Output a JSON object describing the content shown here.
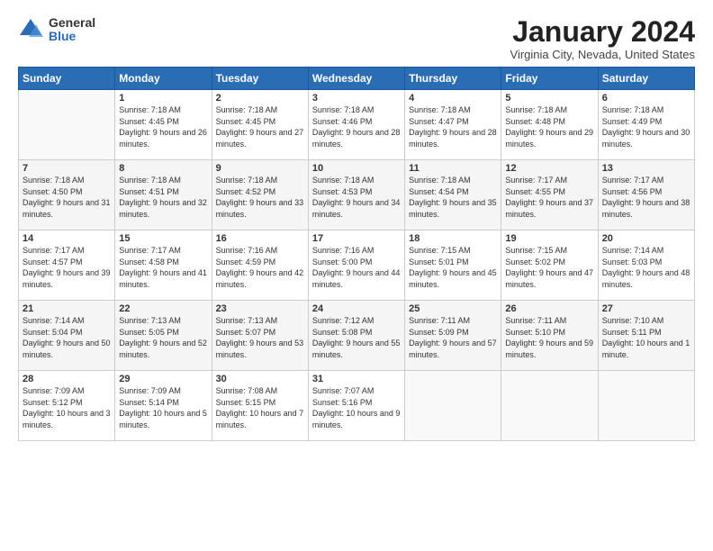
{
  "logo": {
    "general": "General",
    "blue": "Blue"
  },
  "title": "January 2024",
  "subtitle": "Virginia City, Nevada, United States",
  "days_header": [
    "Sunday",
    "Monday",
    "Tuesday",
    "Wednesday",
    "Thursday",
    "Friday",
    "Saturday"
  ],
  "weeks": [
    [
      {
        "day": "",
        "sunrise": "",
        "sunset": "",
        "daylight": ""
      },
      {
        "day": "1",
        "sunrise": "Sunrise: 7:18 AM",
        "sunset": "Sunset: 4:45 PM",
        "daylight": "Daylight: 9 hours and 26 minutes."
      },
      {
        "day": "2",
        "sunrise": "Sunrise: 7:18 AM",
        "sunset": "Sunset: 4:45 PM",
        "daylight": "Daylight: 9 hours and 27 minutes."
      },
      {
        "day": "3",
        "sunrise": "Sunrise: 7:18 AM",
        "sunset": "Sunset: 4:46 PM",
        "daylight": "Daylight: 9 hours and 28 minutes."
      },
      {
        "day": "4",
        "sunrise": "Sunrise: 7:18 AM",
        "sunset": "Sunset: 4:47 PM",
        "daylight": "Daylight: 9 hours and 28 minutes."
      },
      {
        "day": "5",
        "sunrise": "Sunrise: 7:18 AM",
        "sunset": "Sunset: 4:48 PM",
        "daylight": "Daylight: 9 hours and 29 minutes."
      },
      {
        "day": "6",
        "sunrise": "Sunrise: 7:18 AM",
        "sunset": "Sunset: 4:49 PM",
        "daylight": "Daylight: 9 hours and 30 minutes."
      }
    ],
    [
      {
        "day": "7",
        "sunrise": "Sunrise: 7:18 AM",
        "sunset": "Sunset: 4:50 PM",
        "daylight": "Daylight: 9 hours and 31 minutes."
      },
      {
        "day": "8",
        "sunrise": "Sunrise: 7:18 AM",
        "sunset": "Sunset: 4:51 PM",
        "daylight": "Daylight: 9 hours and 32 minutes."
      },
      {
        "day": "9",
        "sunrise": "Sunrise: 7:18 AM",
        "sunset": "Sunset: 4:52 PM",
        "daylight": "Daylight: 9 hours and 33 minutes."
      },
      {
        "day": "10",
        "sunrise": "Sunrise: 7:18 AM",
        "sunset": "Sunset: 4:53 PM",
        "daylight": "Daylight: 9 hours and 34 minutes."
      },
      {
        "day": "11",
        "sunrise": "Sunrise: 7:18 AM",
        "sunset": "Sunset: 4:54 PM",
        "daylight": "Daylight: 9 hours and 35 minutes."
      },
      {
        "day": "12",
        "sunrise": "Sunrise: 7:17 AM",
        "sunset": "Sunset: 4:55 PM",
        "daylight": "Daylight: 9 hours and 37 minutes."
      },
      {
        "day": "13",
        "sunrise": "Sunrise: 7:17 AM",
        "sunset": "Sunset: 4:56 PM",
        "daylight": "Daylight: 9 hours and 38 minutes."
      }
    ],
    [
      {
        "day": "14",
        "sunrise": "Sunrise: 7:17 AM",
        "sunset": "Sunset: 4:57 PM",
        "daylight": "Daylight: 9 hours and 39 minutes."
      },
      {
        "day": "15",
        "sunrise": "Sunrise: 7:17 AM",
        "sunset": "Sunset: 4:58 PM",
        "daylight": "Daylight: 9 hours and 41 minutes."
      },
      {
        "day": "16",
        "sunrise": "Sunrise: 7:16 AM",
        "sunset": "Sunset: 4:59 PM",
        "daylight": "Daylight: 9 hours and 42 minutes."
      },
      {
        "day": "17",
        "sunrise": "Sunrise: 7:16 AM",
        "sunset": "Sunset: 5:00 PM",
        "daylight": "Daylight: 9 hours and 44 minutes."
      },
      {
        "day": "18",
        "sunrise": "Sunrise: 7:15 AM",
        "sunset": "Sunset: 5:01 PM",
        "daylight": "Daylight: 9 hours and 45 minutes."
      },
      {
        "day": "19",
        "sunrise": "Sunrise: 7:15 AM",
        "sunset": "Sunset: 5:02 PM",
        "daylight": "Daylight: 9 hours and 47 minutes."
      },
      {
        "day": "20",
        "sunrise": "Sunrise: 7:14 AM",
        "sunset": "Sunset: 5:03 PM",
        "daylight": "Daylight: 9 hours and 48 minutes."
      }
    ],
    [
      {
        "day": "21",
        "sunrise": "Sunrise: 7:14 AM",
        "sunset": "Sunset: 5:04 PM",
        "daylight": "Daylight: 9 hours and 50 minutes."
      },
      {
        "day": "22",
        "sunrise": "Sunrise: 7:13 AM",
        "sunset": "Sunset: 5:05 PM",
        "daylight": "Daylight: 9 hours and 52 minutes."
      },
      {
        "day": "23",
        "sunrise": "Sunrise: 7:13 AM",
        "sunset": "Sunset: 5:07 PM",
        "daylight": "Daylight: 9 hours and 53 minutes."
      },
      {
        "day": "24",
        "sunrise": "Sunrise: 7:12 AM",
        "sunset": "Sunset: 5:08 PM",
        "daylight": "Daylight: 9 hours and 55 minutes."
      },
      {
        "day": "25",
        "sunrise": "Sunrise: 7:11 AM",
        "sunset": "Sunset: 5:09 PM",
        "daylight": "Daylight: 9 hours and 57 minutes."
      },
      {
        "day": "26",
        "sunrise": "Sunrise: 7:11 AM",
        "sunset": "Sunset: 5:10 PM",
        "daylight": "Daylight: 9 hours and 59 minutes."
      },
      {
        "day": "27",
        "sunrise": "Sunrise: 7:10 AM",
        "sunset": "Sunset: 5:11 PM",
        "daylight": "Daylight: 10 hours and 1 minute."
      }
    ],
    [
      {
        "day": "28",
        "sunrise": "Sunrise: 7:09 AM",
        "sunset": "Sunset: 5:12 PM",
        "daylight": "Daylight: 10 hours and 3 minutes."
      },
      {
        "day": "29",
        "sunrise": "Sunrise: 7:09 AM",
        "sunset": "Sunset: 5:14 PM",
        "daylight": "Daylight: 10 hours and 5 minutes."
      },
      {
        "day": "30",
        "sunrise": "Sunrise: 7:08 AM",
        "sunset": "Sunset: 5:15 PM",
        "daylight": "Daylight: 10 hours and 7 minutes."
      },
      {
        "day": "31",
        "sunrise": "Sunrise: 7:07 AM",
        "sunset": "Sunset: 5:16 PM",
        "daylight": "Daylight: 10 hours and 9 minutes."
      },
      {
        "day": "",
        "sunrise": "",
        "sunset": "",
        "daylight": ""
      },
      {
        "day": "",
        "sunrise": "",
        "sunset": "",
        "daylight": ""
      },
      {
        "day": "",
        "sunrise": "",
        "sunset": "",
        "daylight": ""
      }
    ]
  ]
}
